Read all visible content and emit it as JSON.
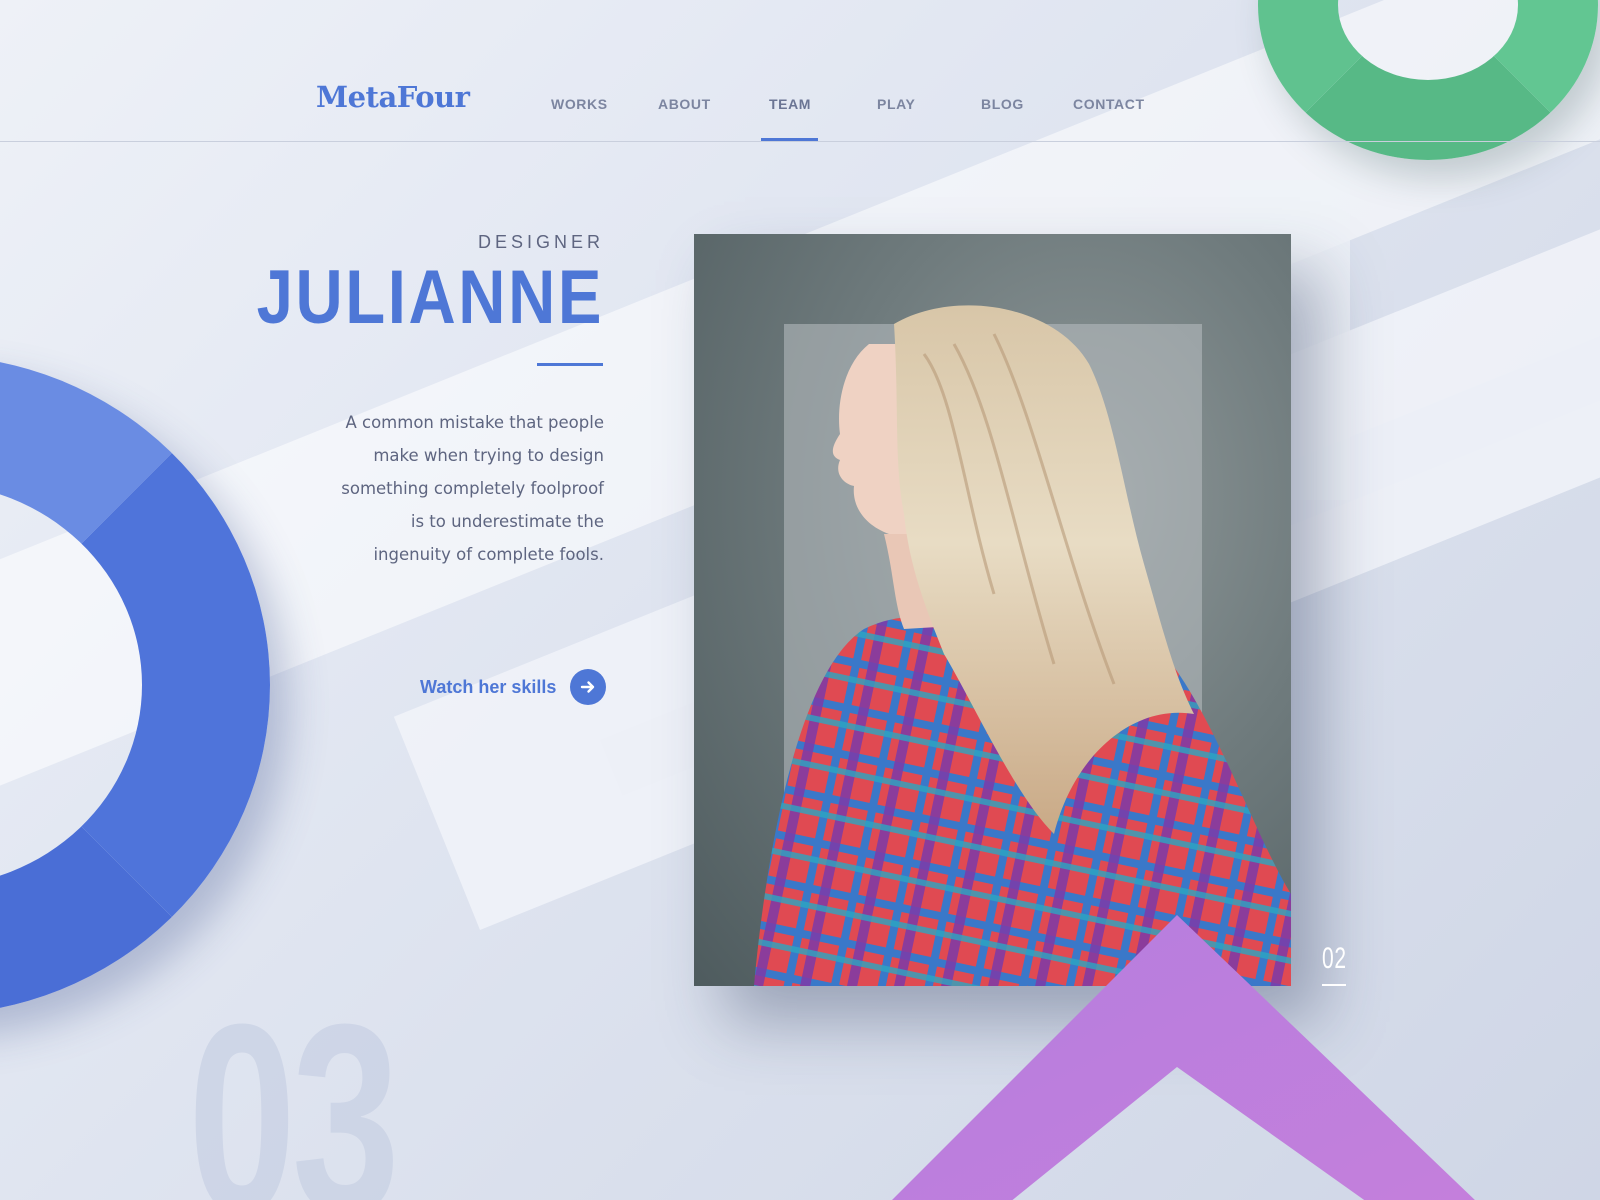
{
  "brand": {
    "logo": "MetaFour"
  },
  "nav": {
    "items": [
      {
        "label": "WORKS"
      },
      {
        "label": "ABOUT"
      },
      {
        "label": "TEAM",
        "active": true
      },
      {
        "label": "PLAY"
      },
      {
        "label": "BLOG"
      },
      {
        "label": "CONTACT"
      }
    ]
  },
  "profile": {
    "role": "DESIGNER",
    "name": "JULIANNE",
    "quote_lines": [
      "A common mistake that people",
      "make when trying to design",
      "something completely foolproof",
      "is to underestimate the",
      "ingenuity of complete fools."
    ],
    "cta_label": "Watch her skills",
    "cta_icon": "arrow-right-icon",
    "photo": "photo-profile"
  },
  "pagination": {
    "current": "02",
    "background": "03"
  },
  "colors": {
    "accent": "#4e77d6",
    "ring_blue": "#5b7fdd",
    "ring_green": "#5cbe8a",
    "chevron_purple": "#b97be0",
    "text_muted": "#5e6580"
  }
}
